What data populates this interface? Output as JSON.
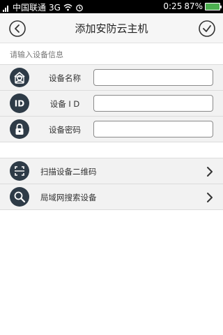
{
  "status": {
    "carrier": "中国联通",
    "network": "3G",
    "time": "0:25",
    "battery": "87%"
  },
  "header": {
    "title": "添加安防云主机"
  },
  "form": {
    "section_label": "请输入设备信息",
    "rows": [
      {
        "label": "设备名称",
        "icon": "device-icon",
        "value": ""
      },
      {
        "label": "设备 I D",
        "icon": "id-icon",
        "value": ""
      },
      {
        "label": "设备密码",
        "icon": "lock-icon",
        "value": ""
      }
    ]
  },
  "actions": [
    {
      "label": "扫描设备二维码",
      "icon": "scan-qr-icon"
    },
    {
      "label": "局域网搜索设备",
      "icon": "search-icon"
    }
  ],
  "colors": {
    "icon_bg": "#2e3b47",
    "battery": "#4caf50"
  }
}
